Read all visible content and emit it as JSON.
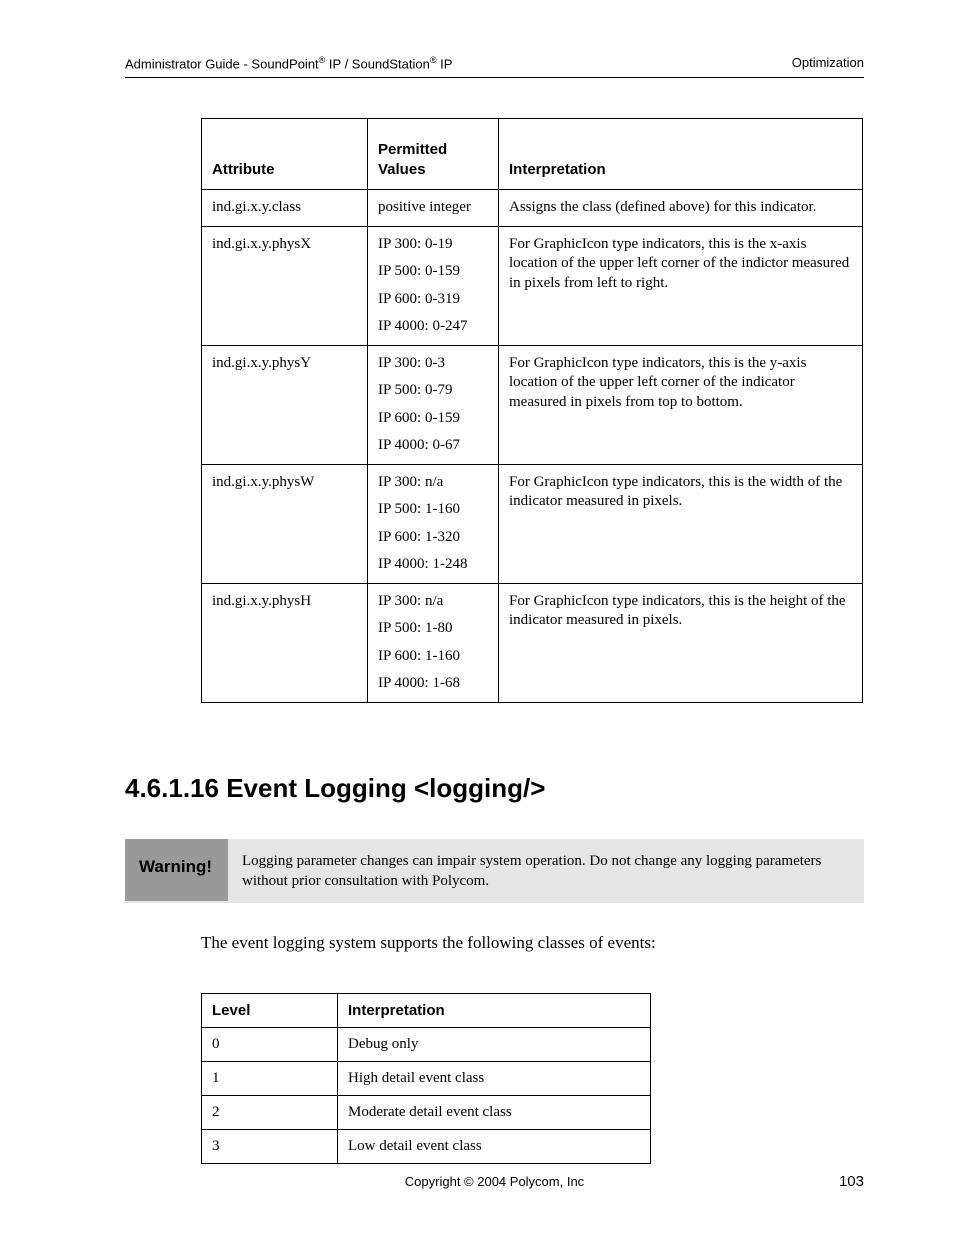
{
  "header": {
    "left_prefix": "Administrator Guide - SoundPoint",
    "left_mid": " IP / SoundStation",
    "left_suffix": " IP",
    "right": "Optimization"
  },
  "table1": {
    "headers": {
      "attr": "Attribute",
      "perm": "Permitted Values",
      "interp": "Interpretation"
    },
    "rows": [
      {
        "attr": "ind.gi.x.y.class",
        "perm": [
          "positive integer"
        ],
        "interp": "Assigns the class (defined above) for this indicator."
      },
      {
        "attr": "ind.gi.x.y.physX",
        "perm": [
          "IP 300: 0-19",
          "IP 500: 0-159",
          "IP 600: 0-319",
          "IP 4000: 0-247"
        ],
        "interp": "For GraphicIcon type indicators, this is the x-axis location of the upper left corner of the indictor measured in pixels from left to right."
      },
      {
        "attr": "ind.gi.x.y.physY",
        "perm": [
          "IP 300: 0-3",
          "IP 500: 0-79",
          "IP 600: 0-159",
          "IP 4000: 0-67"
        ],
        "interp": "For GraphicIcon type indicators, this is the y-axis location of the upper left corner of the indicator measured in pixels from top to bottom."
      },
      {
        "attr": "ind.gi.x.y.physW",
        "perm": [
          "IP 300: n/a",
          "IP 500: 1-160",
          "IP 600: 1-320",
          "IP 4000: 1-248"
        ],
        "interp": "For GraphicIcon type indicators, this is the width of the indicator measured in pixels."
      },
      {
        "attr": "ind.gi.x.y.physH",
        "perm": [
          "IP 300: n/a",
          "IP 500: 1-80",
          "IP 600: 1-160",
          "IP 4000: 1-68"
        ],
        "interp": "For GraphicIcon type indicators, this is the height of the indicator measured in pixels."
      }
    ]
  },
  "section_heading": "4.6.1.16  Event Logging <logging/>",
  "warning": {
    "label": "Warning!",
    "text": "Logging parameter changes can impair system operation.  Do not change any logging parameters without prior consultation with Polycom."
  },
  "body_text": "The event logging system supports the following classes of events:",
  "table2": {
    "headers": {
      "level": "Level",
      "interp": "Interpretation"
    },
    "rows": [
      {
        "level": "0",
        "interp": "Debug only"
      },
      {
        "level": "1",
        "interp": "High detail event class"
      },
      {
        "level": "2",
        "interp": "Moderate detail event class"
      },
      {
        "level": "3",
        "interp": "Low detail event class"
      }
    ]
  },
  "footer": {
    "center": "Copyright © 2004 Polycom, Inc",
    "page": "103"
  }
}
